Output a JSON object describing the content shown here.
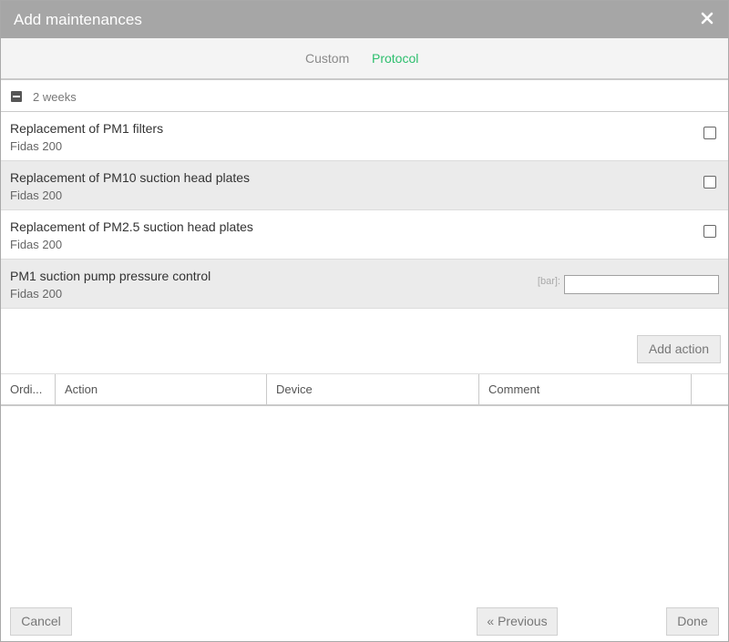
{
  "dialog": {
    "title": "Add maintenances",
    "close_icon": "close-icon"
  },
  "tabs": [
    {
      "label": "Custom",
      "active": false
    },
    {
      "label": "Protocol",
      "active": true
    }
  ],
  "accent_color": "#2ebf6e",
  "group": {
    "label": "2 weeks",
    "icon": "collapse-icon"
  },
  "items": [
    {
      "name": "Replacement of PM1 filters",
      "device": "Fidas 200",
      "checked": false
    },
    {
      "name": "Replacement of PM10 suction head plates",
      "device": "Fidas 200",
      "checked": false
    },
    {
      "name": "Replacement of PM2.5 suction head plates",
      "device": "Fidas 200",
      "checked": false
    },
    {
      "name": "PM1 suction pump pressure control",
      "device": "Fidas 200",
      "unit": "[bar]:",
      "value": ""
    }
  ],
  "add_action_label": "Add action",
  "table": {
    "columns": [
      "Ordi...",
      "Action",
      "Device",
      "Comment"
    ],
    "rows": []
  },
  "footer": {
    "cancel_label": "Cancel",
    "previous_label": "« Previous",
    "done_label": "Done"
  }
}
